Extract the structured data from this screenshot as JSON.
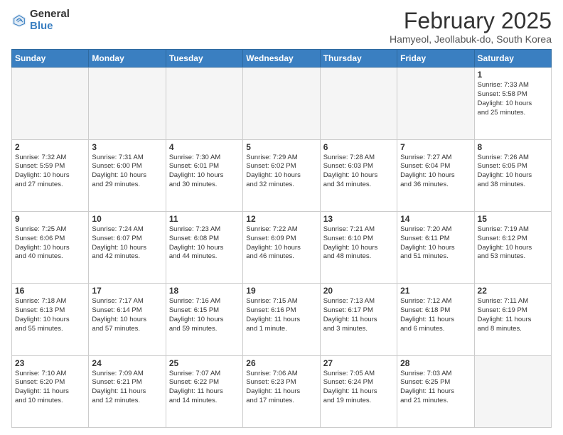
{
  "logo": {
    "general": "General",
    "blue": "Blue"
  },
  "header": {
    "month": "February 2025",
    "location": "Hamyeol, Jeollabuk-do, South Korea"
  },
  "days_of_week": [
    "Sunday",
    "Monday",
    "Tuesday",
    "Wednesday",
    "Thursday",
    "Friday",
    "Saturday"
  ],
  "weeks": [
    [
      {
        "day": "",
        "info": ""
      },
      {
        "day": "",
        "info": ""
      },
      {
        "day": "",
        "info": ""
      },
      {
        "day": "",
        "info": ""
      },
      {
        "day": "",
        "info": ""
      },
      {
        "day": "",
        "info": ""
      },
      {
        "day": "1",
        "info": "Sunrise: 7:33 AM\nSunset: 5:58 PM\nDaylight: 10 hours\nand 25 minutes."
      }
    ],
    [
      {
        "day": "2",
        "info": "Sunrise: 7:32 AM\nSunset: 5:59 PM\nDaylight: 10 hours\nand 27 minutes."
      },
      {
        "day": "3",
        "info": "Sunrise: 7:31 AM\nSunset: 6:00 PM\nDaylight: 10 hours\nand 29 minutes."
      },
      {
        "day": "4",
        "info": "Sunrise: 7:30 AM\nSunset: 6:01 PM\nDaylight: 10 hours\nand 30 minutes."
      },
      {
        "day": "5",
        "info": "Sunrise: 7:29 AM\nSunset: 6:02 PM\nDaylight: 10 hours\nand 32 minutes."
      },
      {
        "day": "6",
        "info": "Sunrise: 7:28 AM\nSunset: 6:03 PM\nDaylight: 10 hours\nand 34 minutes."
      },
      {
        "day": "7",
        "info": "Sunrise: 7:27 AM\nSunset: 6:04 PM\nDaylight: 10 hours\nand 36 minutes."
      },
      {
        "day": "8",
        "info": "Sunrise: 7:26 AM\nSunset: 6:05 PM\nDaylight: 10 hours\nand 38 minutes."
      }
    ],
    [
      {
        "day": "9",
        "info": "Sunrise: 7:25 AM\nSunset: 6:06 PM\nDaylight: 10 hours\nand 40 minutes."
      },
      {
        "day": "10",
        "info": "Sunrise: 7:24 AM\nSunset: 6:07 PM\nDaylight: 10 hours\nand 42 minutes."
      },
      {
        "day": "11",
        "info": "Sunrise: 7:23 AM\nSunset: 6:08 PM\nDaylight: 10 hours\nand 44 minutes."
      },
      {
        "day": "12",
        "info": "Sunrise: 7:22 AM\nSunset: 6:09 PM\nDaylight: 10 hours\nand 46 minutes."
      },
      {
        "day": "13",
        "info": "Sunrise: 7:21 AM\nSunset: 6:10 PM\nDaylight: 10 hours\nand 48 minutes."
      },
      {
        "day": "14",
        "info": "Sunrise: 7:20 AM\nSunset: 6:11 PM\nDaylight: 10 hours\nand 51 minutes."
      },
      {
        "day": "15",
        "info": "Sunrise: 7:19 AM\nSunset: 6:12 PM\nDaylight: 10 hours\nand 53 minutes."
      }
    ],
    [
      {
        "day": "16",
        "info": "Sunrise: 7:18 AM\nSunset: 6:13 PM\nDaylight: 10 hours\nand 55 minutes."
      },
      {
        "day": "17",
        "info": "Sunrise: 7:17 AM\nSunset: 6:14 PM\nDaylight: 10 hours\nand 57 minutes."
      },
      {
        "day": "18",
        "info": "Sunrise: 7:16 AM\nSunset: 6:15 PM\nDaylight: 10 hours\nand 59 minutes."
      },
      {
        "day": "19",
        "info": "Sunrise: 7:15 AM\nSunset: 6:16 PM\nDaylight: 11 hours\nand 1 minute."
      },
      {
        "day": "20",
        "info": "Sunrise: 7:13 AM\nSunset: 6:17 PM\nDaylight: 11 hours\nand 3 minutes."
      },
      {
        "day": "21",
        "info": "Sunrise: 7:12 AM\nSunset: 6:18 PM\nDaylight: 11 hours\nand 6 minutes."
      },
      {
        "day": "22",
        "info": "Sunrise: 7:11 AM\nSunset: 6:19 PM\nDaylight: 11 hours\nand 8 minutes."
      }
    ],
    [
      {
        "day": "23",
        "info": "Sunrise: 7:10 AM\nSunset: 6:20 PM\nDaylight: 11 hours\nand 10 minutes."
      },
      {
        "day": "24",
        "info": "Sunrise: 7:09 AM\nSunset: 6:21 PM\nDaylight: 11 hours\nand 12 minutes."
      },
      {
        "day": "25",
        "info": "Sunrise: 7:07 AM\nSunset: 6:22 PM\nDaylight: 11 hours\nand 14 minutes."
      },
      {
        "day": "26",
        "info": "Sunrise: 7:06 AM\nSunset: 6:23 PM\nDaylight: 11 hours\nand 17 minutes."
      },
      {
        "day": "27",
        "info": "Sunrise: 7:05 AM\nSunset: 6:24 PM\nDaylight: 11 hours\nand 19 minutes."
      },
      {
        "day": "28",
        "info": "Sunrise: 7:03 AM\nSunset: 6:25 PM\nDaylight: 11 hours\nand 21 minutes."
      },
      {
        "day": "",
        "info": ""
      }
    ]
  ]
}
